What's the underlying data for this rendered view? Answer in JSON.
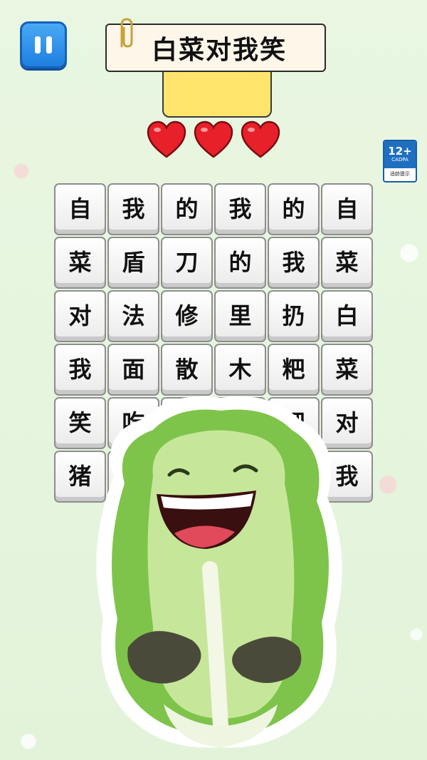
{
  "game": {
    "title": "白菜对我笑",
    "lives": 3
  },
  "age_rating": {
    "rating": "12+",
    "org": "CADPA",
    "note": "适龄提示"
  },
  "grid": [
    [
      "自",
      "我",
      "的",
      "我",
      "的",
      "自"
    ],
    [
      "菜",
      "盾",
      "刀",
      "的",
      "我",
      "菜"
    ],
    [
      "对",
      "法",
      "修",
      "里",
      "扔",
      "白"
    ],
    [
      "我",
      "面",
      "散",
      "木",
      "粑",
      "菜"
    ],
    [
      "笑",
      "吃",
      "",
      "",
      "粑",
      "对"
    ],
    [
      "猪",
      "",
      "",
      "",
      "",
      "我"
    ]
  ],
  "colors": {
    "background": "#e6f5de",
    "pause_button": "#1f7fe0",
    "heart": "#e8202a",
    "title_tab": "#ffe46b"
  },
  "icons": {
    "pause": "pause-icon",
    "clip": "paperclip-icon",
    "heart": "heart-icon"
  }
}
